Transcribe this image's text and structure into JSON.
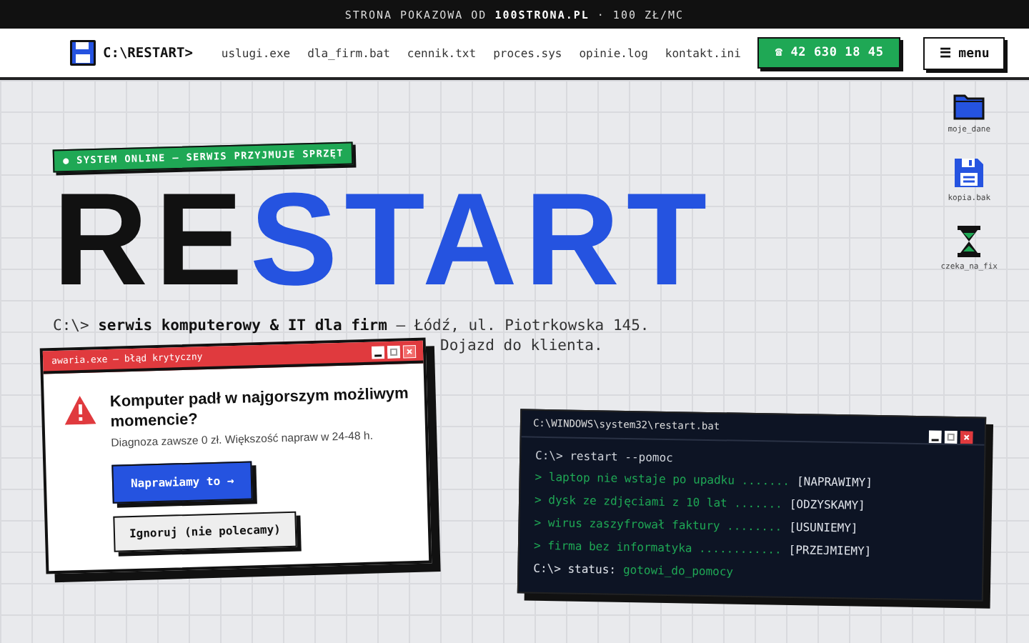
{
  "promo_bar": {
    "text": "STRONA POKAZOWA OD **100STRONA.PL** · 100 ZŁ/MC"
  },
  "nav": {
    "logo": "C:\\RESTART>",
    "links": [
      "uslugi.exe",
      "dla_firm.bat",
      "cennik.txt",
      "proces.sys",
      "opinie.log",
      "kontakt.ini"
    ],
    "phone": "☎ 42 630 18 45",
    "menu": "☰ menu"
  },
  "hero": {
    "badge": "● SYSTEM ONLINE — SERWIS PRZYJMUJE SPRZĘT",
    "title_dark": "RE",
    "title_blue": "START",
    "line_1": "C:\\> **serwis komputerowy & IT dla firm** — Łódź, ul. Piotrkowska 145.",
    "line_2_end": "Dojazd do klienta."
  },
  "desktop_icons": [
    {
      "kind": "folder",
      "label": "moje_dane"
    },
    {
      "kind": "floppy",
      "label": "kopia.bak"
    },
    {
      "kind": "hourglass",
      "label": "czeka_na_fix"
    }
  ],
  "error_dialog": {
    "title": "awaria.exe — błąd krytyczny",
    "heading": "Komputer padł w najgorszym możliwym momencie?",
    "text": "Diagnoza zawsze 0 zł. Większość napraw w 24-48 h.",
    "buttons": [
      {
        "label": "Naprawiamy to →",
        "kind": "primary"
      },
      {
        "label": "Ignoruj (nie polecamy)",
        "kind": "secondary"
      }
    ]
  },
  "terminal": {
    "title": "C:\\WINDOWS\\system32\\restart.bat",
    "command": "C:\\> restart --pomoc",
    "lines": [
      {
        "text": "> laptop nie wstaje po upadku .......",
        "result": "[NAPRAWIMY]"
      },
      {
        "text": "> dysk ze zdjęciami z 10 lat .......",
        "result": "[ODZYSKAMY]"
      },
      {
        "text": "> wirus zaszyfrował faktury ........",
        "result": "[USUNIEMY]"
      },
      {
        "text": "> firma bez informatyka ............",
        "result": "[PRZEJMIEMY]"
      }
    ],
    "status_label": "C:\\> status:",
    "status_value": "gotowi_do_pomocy"
  }
}
